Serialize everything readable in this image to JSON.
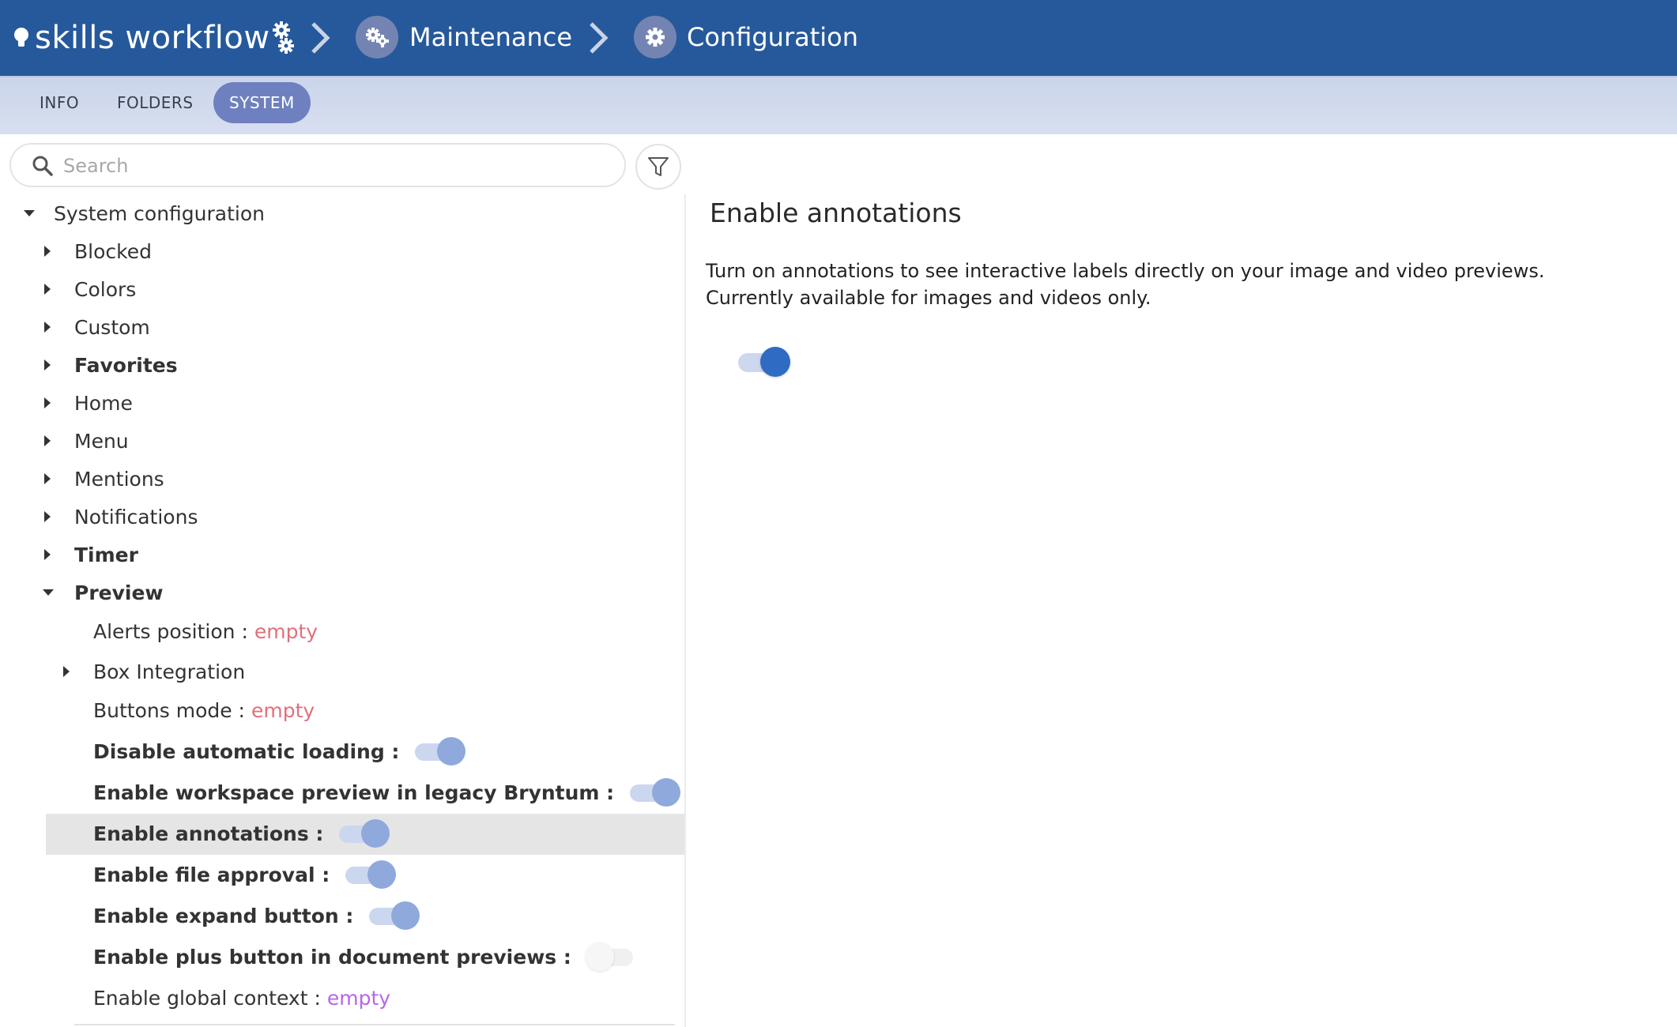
{
  "header": {
    "logo_text": "skills workflow",
    "breadcrumbs": [
      {
        "label": "Maintenance",
        "icon": "gears-icon"
      },
      {
        "label": "Configuration",
        "icon": "gear-icon"
      }
    ],
    "colors": {
      "bar": "#26599b",
      "crumb_circle": "#7484b2"
    }
  },
  "tabs": [
    {
      "label": "INFO",
      "active": false
    },
    {
      "label": "FOLDERS",
      "active": false
    },
    {
      "label": "SYSTEM",
      "active": true
    }
  ],
  "search": {
    "placeholder": "Search",
    "value": ""
  },
  "tree": {
    "root": "System configuration",
    "items": [
      "Blocked",
      "Colors",
      "Custom",
      "Favorites",
      "Home",
      "Menu",
      "Mentions",
      "Notifications",
      "Timer",
      "Preview"
    ],
    "preview": {
      "alerts_position": {
        "label": "Alerts position :",
        "value": "empty"
      },
      "box_integration": "Box Integration",
      "buttons_mode": {
        "label": "Buttons mode :",
        "value": "empty"
      },
      "disable_automatic_loading": {
        "label": "Disable automatic loading :",
        "on": true
      },
      "enable_workspace_preview": {
        "label": "Enable workspace preview in legacy Bryntum :",
        "on": true
      },
      "enable_annotations": {
        "label": "Enable annotations :",
        "on": true,
        "selected": true
      },
      "enable_file_approval": {
        "label": "Enable file approval :",
        "on": true
      },
      "enable_expand_button": {
        "label": "Enable expand button :",
        "on": true
      },
      "enable_plus_button": {
        "label": "Enable plus button in document previews :",
        "on": false
      },
      "enable_global_context": {
        "label": "Enable global context :",
        "value": "empty"
      }
    }
  },
  "detail": {
    "title": "Enable annotations",
    "description_line1": "Turn on annotations to see interactive labels directly on your image and video previews.",
    "description_line2": "Currently available for images and videos only.",
    "toggle_on": true
  }
}
